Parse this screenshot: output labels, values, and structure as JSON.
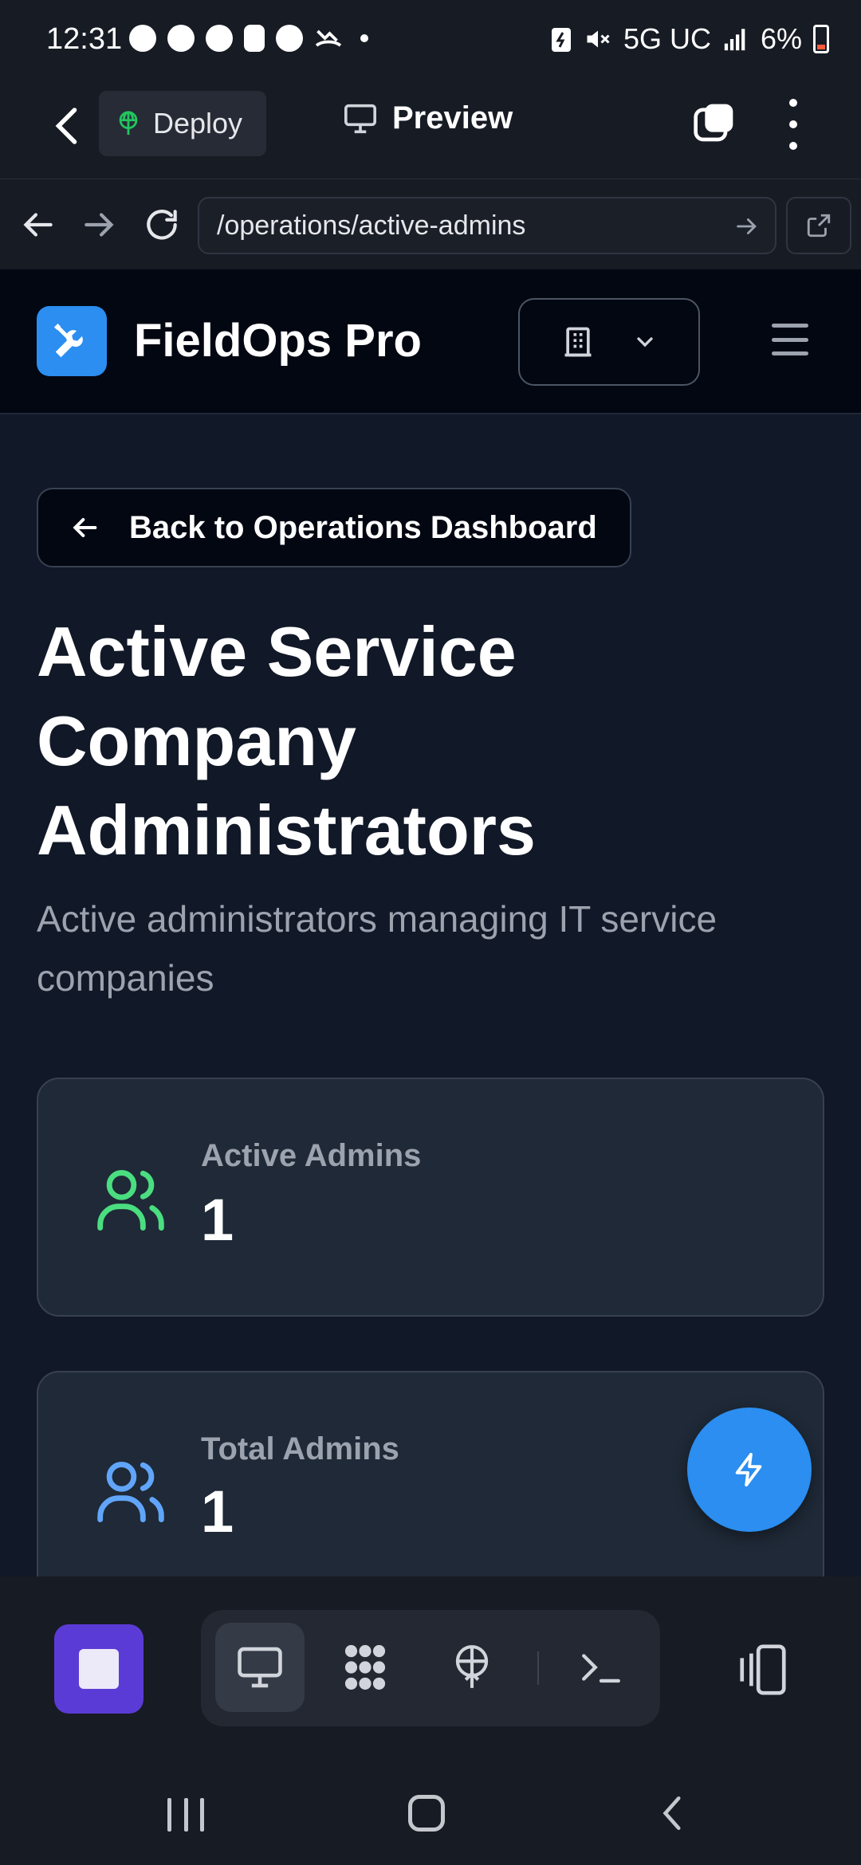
{
  "status_bar": {
    "time": "12:31",
    "network": "5G UC",
    "battery": "6%",
    "battery_color": "#ff5a3c"
  },
  "app_bar": {
    "deploy_label": "Deploy",
    "preview_label": "Preview"
  },
  "browser": {
    "url": "/operations/active-admins"
  },
  "site": {
    "brand": "FieldOps Pro",
    "accent_color": "#2b8ef0"
  },
  "page": {
    "back_label": "Back to Operations Dashboard",
    "title": "Active Service Company Administrators",
    "subtitle": "Active administrators managing IT service companies"
  },
  "stats": [
    {
      "label": "Active Admins",
      "value": "1",
      "icon": "users-icon",
      "icon_color": "#4ade80"
    },
    {
      "label": "Total Admins",
      "value": "1",
      "icon": "users-icon",
      "icon_color": "#60a5fa"
    }
  ],
  "toolbar": {
    "stop_color": "#5b3bd6",
    "tools": [
      "monitor-icon",
      "grid-icon",
      "deploy-icon",
      "terminal-icon"
    ]
  }
}
